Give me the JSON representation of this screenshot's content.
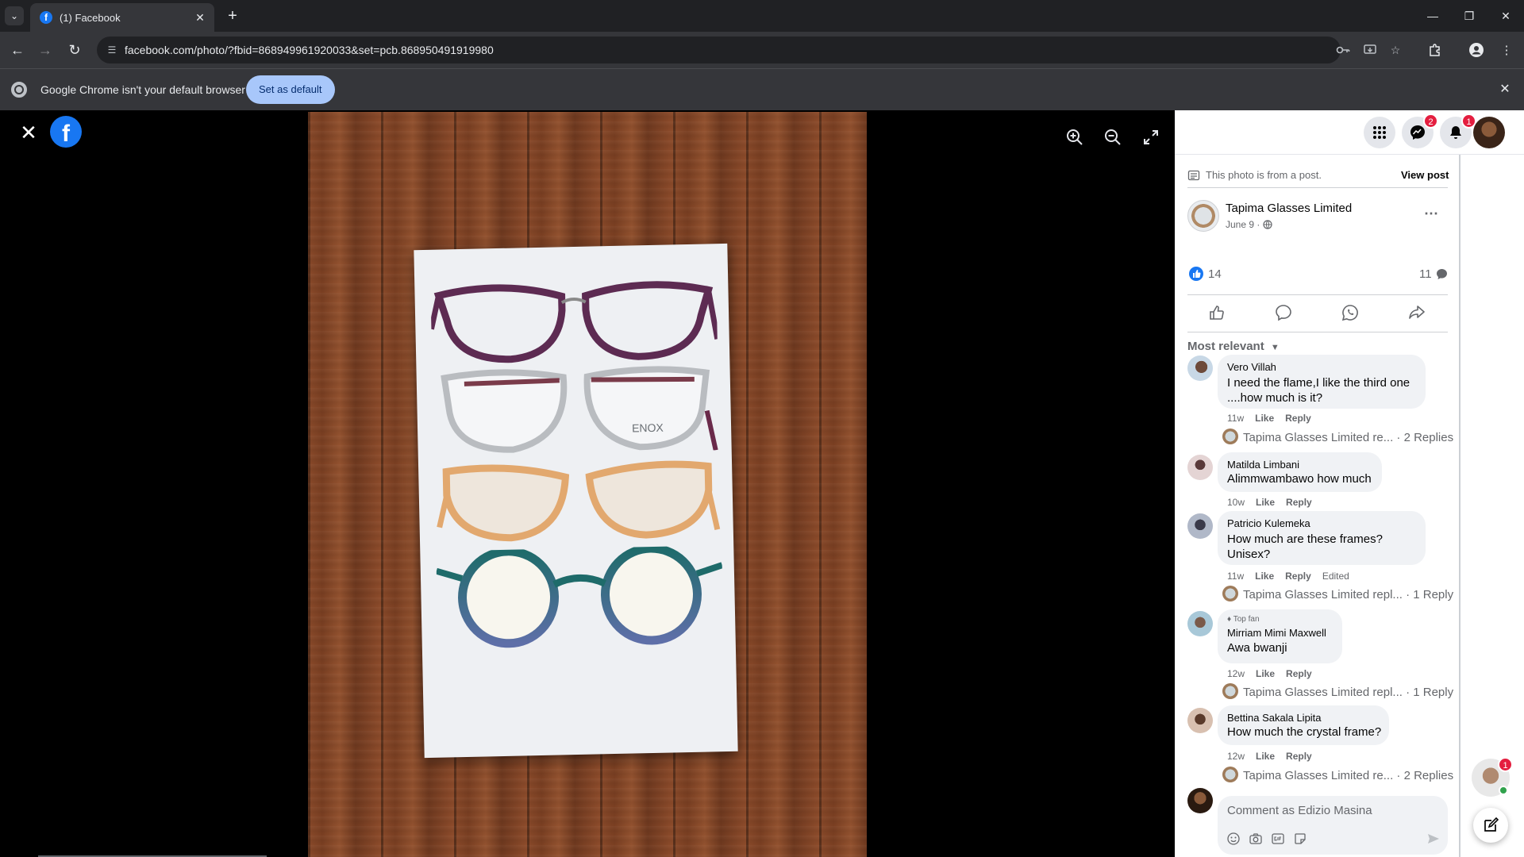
{
  "browser": {
    "tab": {
      "title": "(1) Facebook",
      "favicon": "f"
    },
    "new_tab": "+",
    "url": "facebook.com/photo/?fbid=868949961920033&set=pcb.868950491919980",
    "infobar": {
      "message": "Google Chrome isn't your default browser",
      "button": "Set as default"
    }
  },
  "viewer": {
    "logo": "f",
    "photo_alt": "Four pairs of eyeglass frames on a white card over a wooden table",
    "frame_brand": "ENOX"
  },
  "panel": {
    "header_badges": {
      "messenger": "2",
      "notifications": "1"
    },
    "post_notice": "This photo is from a post.",
    "view_post": "View post",
    "author": "Tapima Glasses Limited",
    "date": "June 9 ·",
    "likes": "14",
    "comments_count": "11",
    "sort_label": "Most relevant",
    "comments": [
      {
        "name": "Vero Villah",
        "text_lines": [
          "I need the flame,I like the third one",
          "....how much is it?"
        ],
        "time": "11w",
        "like": "Like",
        "reply": "Reply",
        "reply_summary": "Tapima Glasses Limited re... · 2 Replies"
      },
      {
        "name": "Matilda Limbani",
        "text_lines": [
          "Alimmwambawo how much"
        ],
        "time": "10w",
        "like": "Like",
        "reply": "Reply"
      },
      {
        "name": "Patricio Kulemeka",
        "text_lines": [
          "How much are these frames?",
          "Unisex?"
        ],
        "time": "11w",
        "like": "Like",
        "reply": "Reply",
        "edited": "Edited",
        "reply_summary": "Tapima Glasses Limited repl... · 1 Reply"
      },
      {
        "badge": "Top fan",
        "name": "Mirriam Mimi Maxwell",
        "text_lines": [
          "Awa bwanji"
        ],
        "time": "12w",
        "like": "Like",
        "reply": "Reply",
        "reply_summary": "Tapima Glasses Limited repl... · 1 Reply"
      },
      {
        "name": "Bettina Sakala Lipita",
        "text_lines": [
          "How much the crystal frame?"
        ],
        "time": "12w",
        "like": "Like",
        "reply": "Reply",
        "reply_summary": "Tapima Glasses Limited re... · 2 Replies"
      }
    ],
    "composer_placeholder": "Comment as Edizio Masina",
    "chat_badge": "1"
  },
  "colors": {
    "facebook_blue": "#1877f2",
    "badge_red": "#e41e3f",
    "chrome_dark": "#202124",
    "chrome_toolbar": "#35363a"
  }
}
